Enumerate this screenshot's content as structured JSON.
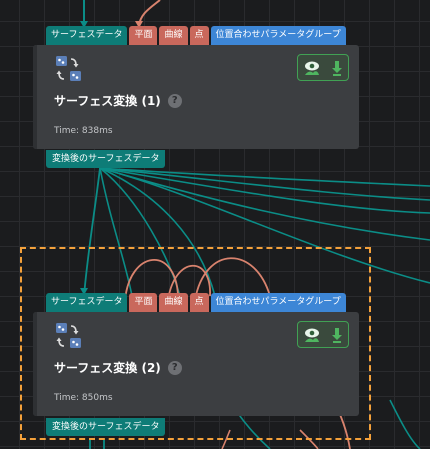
{
  "colors": {
    "teal_port": "#0e7c77",
    "salmon_port": "#c9685c",
    "blue_port": "#3d86d6",
    "node_bg": "#3c3e41",
    "selection": "#f4a13b",
    "teal_wire": "#0b8d87",
    "salmon_wire": "#d9836e",
    "action_green": "#41a154"
  },
  "nodes": [
    {
      "inputs": [
        "サーフェスデータ",
        "平面",
        "曲線",
        "点",
        "位置合わせパラメータグループ"
      ],
      "title": "サーフェス変換 (1)",
      "help": "?",
      "time": "Time: 838ms",
      "output": "変換後のサーフェスデータ",
      "icons": [
        "transform-icon",
        "visibility-icon",
        "download-icon"
      ]
    },
    {
      "inputs": [
        "サーフェスデータ",
        "平面",
        "曲線",
        "点",
        "位置合わせパラメータグループ"
      ],
      "title": "サーフェス変換 (2)",
      "help": "?",
      "time": "Time: 850ms",
      "output": "変換後のサーフェスデータ",
      "icons": [
        "transform-icon",
        "visibility-icon",
        "download-icon"
      ],
      "selected": true
    }
  ]
}
